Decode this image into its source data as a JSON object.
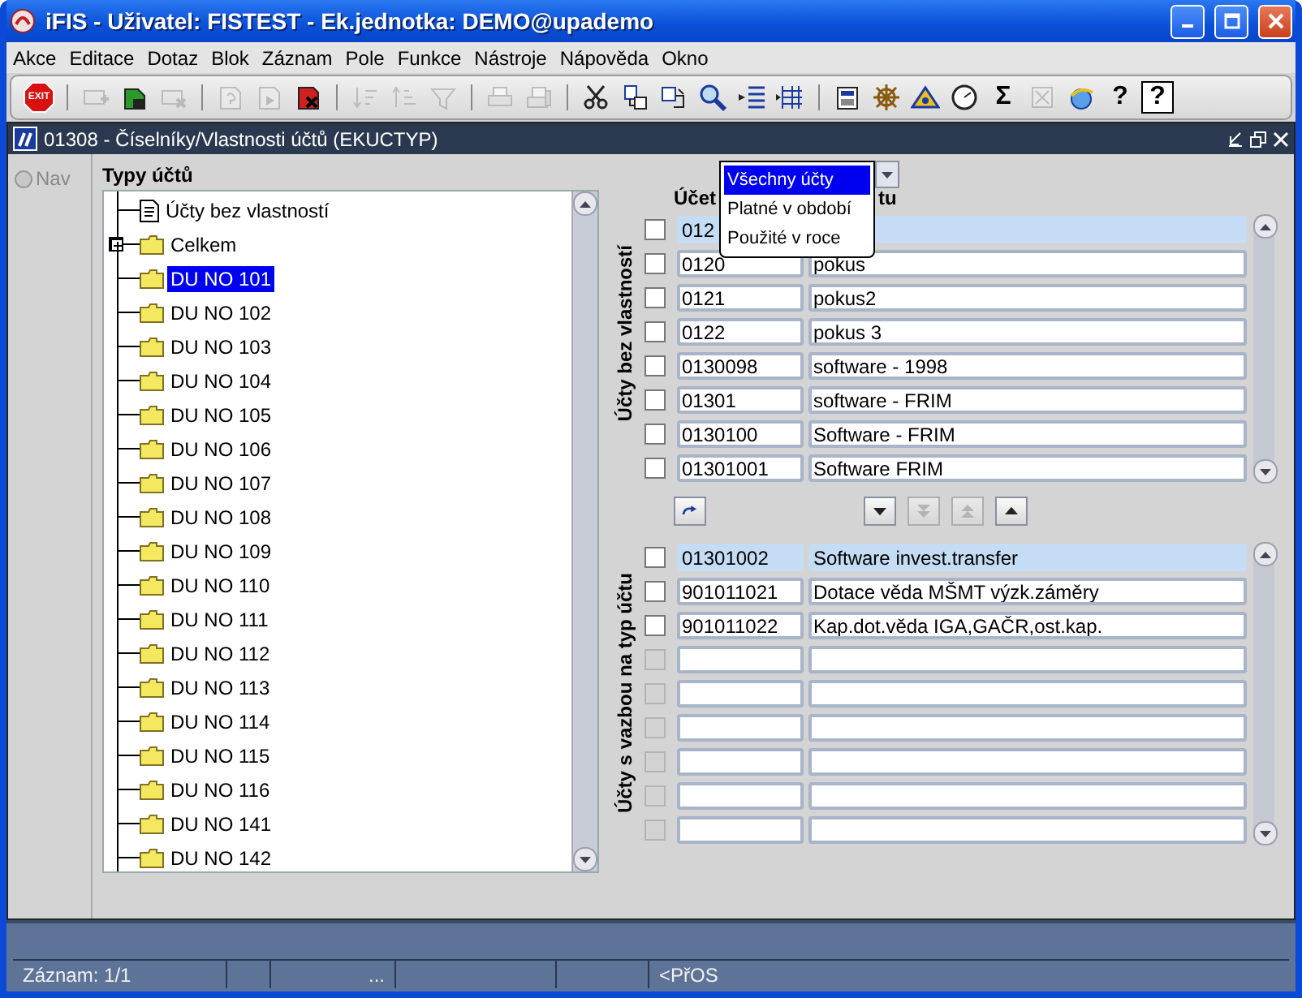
{
  "window": {
    "title": "iFIS - Uživatel: FISTEST - Ek.jednotka: DEMO@upademo"
  },
  "menu": [
    "Akce",
    "Editace",
    "Dotaz",
    "Blok",
    "Záznam",
    "Pole",
    "Funkce",
    "Nástroje",
    "Nápověda",
    "Okno"
  ],
  "toolbar": [
    {
      "kind": "exit",
      "disabled": false,
      "label": "EXIT"
    },
    {
      "kind": "sep"
    },
    {
      "kind": "insert",
      "disabled": true
    },
    {
      "kind": "save",
      "disabled": false
    },
    {
      "kind": "remove",
      "disabled": true
    },
    {
      "kind": "sep"
    },
    {
      "kind": "query",
      "disabled": true
    },
    {
      "kind": "execute",
      "disabled": true
    },
    {
      "kind": "cancel",
      "disabled": false
    },
    {
      "kind": "sep"
    },
    {
      "kind": "sort-asc",
      "disabled": true
    },
    {
      "kind": "sort-desc",
      "disabled": true
    },
    {
      "kind": "filter",
      "disabled": true
    },
    {
      "kind": "sep"
    },
    {
      "kind": "print",
      "disabled": true
    },
    {
      "kind": "print-setup",
      "disabled": true
    },
    {
      "kind": "sep"
    },
    {
      "kind": "cut",
      "disabled": false
    },
    {
      "kind": "copy",
      "disabled": false
    },
    {
      "kind": "paste",
      "disabled": false
    },
    {
      "kind": "find",
      "disabled": false
    },
    {
      "kind": "list",
      "disabled": false
    },
    {
      "kind": "columns",
      "disabled": false
    },
    {
      "kind": "sep"
    },
    {
      "kind": "calc",
      "disabled": false
    },
    {
      "kind": "wheel",
      "disabled": false
    },
    {
      "kind": "triangle",
      "disabled": false
    },
    {
      "kind": "clock",
      "disabled": false
    },
    {
      "kind": "sum",
      "disabled": false,
      "label": "Σ"
    },
    {
      "kind": "grid",
      "disabled": true
    },
    {
      "kind": "globe",
      "disabled": false
    },
    {
      "kind": "key-help",
      "disabled": false,
      "label": "?"
    },
    {
      "kind": "help",
      "disabled": false,
      "label": "?"
    }
  ],
  "form": {
    "title": "01308 - Číselníky/Vlastnosti účtů (EKUCTYP)"
  },
  "nav": {
    "label": "Nav",
    "selected": false
  },
  "tree": {
    "title": "Typy účtů",
    "items": [
      {
        "kind": "document",
        "label": "Účty bez vlastností",
        "selected": false,
        "expandable": false
      },
      {
        "kind": "folder",
        "label": "Celkem",
        "selected": false,
        "expandable": true
      },
      {
        "kind": "folder",
        "label": "DU NO 101",
        "selected": true,
        "expandable": false
      },
      {
        "kind": "folder",
        "label": "DU NO 102",
        "selected": false,
        "expandable": false
      },
      {
        "kind": "folder",
        "label": "DU NO 103",
        "selected": false,
        "expandable": false
      },
      {
        "kind": "folder",
        "label": "DU NO 104",
        "selected": false,
        "expandable": false
      },
      {
        "kind": "folder",
        "label": "DU NO 105",
        "selected": false,
        "expandable": false
      },
      {
        "kind": "folder",
        "label": "DU NO 106",
        "selected": false,
        "expandable": false
      },
      {
        "kind": "folder",
        "label": "DU NO 107",
        "selected": false,
        "expandable": false
      },
      {
        "kind": "folder",
        "label": "DU NO 108",
        "selected": false,
        "expandable": false
      },
      {
        "kind": "folder",
        "label": "DU NO 109",
        "selected": false,
        "expandable": false
      },
      {
        "kind": "folder",
        "label": "DU NO 110",
        "selected": false,
        "expandable": false
      },
      {
        "kind": "folder",
        "label": "DU NO 111",
        "selected": false,
        "expandable": false
      },
      {
        "kind": "folder",
        "label": "DU NO 112",
        "selected": false,
        "expandable": false
      },
      {
        "kind": "folder",
        "label": "DU NO 113",
        "selected": false,
        "expandable": false
      },
      {
        "kind": "folder",
        "label": "DU NO 114",
        "selected": false,
        "expandable": false
      },
      {
        "kind": "folder",
        "label": "DU NO 115",
        "selected": false,
        "expandable": false
      },
      {
        "kind": "folder",
        "label": "DU NO 116",
        "selected": false,
        "expandable": false
      },
      {
        "kind": "folder",
        "label": "DU NO 141",
        "selected": false,
        "expandable": false
      },
      {
        "kind": "folder",
        "label": "DU NO 142",
        "selected": false,
        "expandable": false
      }
    ]
  },
  "filter_dropdown": {
    "options": [
      {
        "label": "Všechny účty",
        "selected": true
      },
      {
        "label": "Platné v období",
        "selected": false
      },
      {
        "label": "Použité v roce",
        "selected": false
      }
    ]
  },
  "upper": {
    "label": "Účty bez vlastností",
    "columns": [
      "Účet",
      "tu"
    ],
    "rows": [
      {
        "code": "012",
        "checked": false,
        "selected": true,
        "disabled": false
      },
      {
        "code": "0120",
        "name": "pokus",
        "checked": false,
        "selected": false,
        "disabled": false
      },
      {
        "code": "0121",
        "name": "pokus2",
        "checked": false,
        "selected": false,
        "disabled": false
      },
      {
        "code": "0122",
        "name": "pokus 3",
        "checked": false,
        "selected": false,
        "disabled": false
      },
      {
        "code": "0130098",
        "name": "software - 1998",
        "checked": false,
        "selected": false,
        "disabled": false
      },
      {
        "code": "01301",
        "name": "software - FRIM",
        "checked": false,
        "selected": false,
        "disabled": false
      },
      {
        "code": "0130100",
        "name": "Software - FRIM",
        "checked": false,
        "selected": false,
        "disabled": false
      },
      {
        "code": "01301001",
        "name": "Software FRIM",
        "checked": false,
        "selected": false,
        "disabled": false
      }
    ]
  },
  "record_buttons": [
    {
      "kind": "refresh",
      "disabled": false
    },
    {
      "kind": "down",
      "disabled": false
    },
    {
      "kind": "all-down",
      "disabled": true
    },
    {
      "kind": "all-up",
      "disabled": true
    },
    {
      "kind": "up",
      "disabled": false
    }
  ],
  "lower": {
    "label": "Účty s vazbou na typ účtu",
    "rows": [
      {
        "code": "01301002",
        "name": "Software invest.transfer",
        "checked": false,
        "selected": true,
        "disabled": false
      },
      {
        "code": "901011021",
        "name": "Dotace věda MŠMT výzk.záměry",
        "checked": false,
        "selected": false,
        "disabled": false
      },
      {
        "code": "901011022",
        "name": "Kap.dot.věda IGA,GAČR,ost.kap.",
        "checked": false,
        "selected": false,
        "disabled": false
      },
      {
        "checked": false,
        "selected": false,
        "disabled": true
      },
      {
        "checked": false,
        "selected": false,
        "disabled": true
      },
      {
        "checked": false,
        "selected": false,
        "disabled": true
      },
      {
        "checked": false,
        "selected": false,
        "disabled": true
      },
      {
        "checked": false,
        "selected": false,
        "disabled": true
      },
      {
        "checked": false,
        "selected": false,
        "disabled": true
      }
    ]
  },
  "status_bar": {
    "cells": [
      {
        "text": "Záznam: 1/1"
      },
      {},
      {
        "text": "..."
      },
      {},
      {},
      {
        "text": "<PřOS"
      }
    ]
  }
}
